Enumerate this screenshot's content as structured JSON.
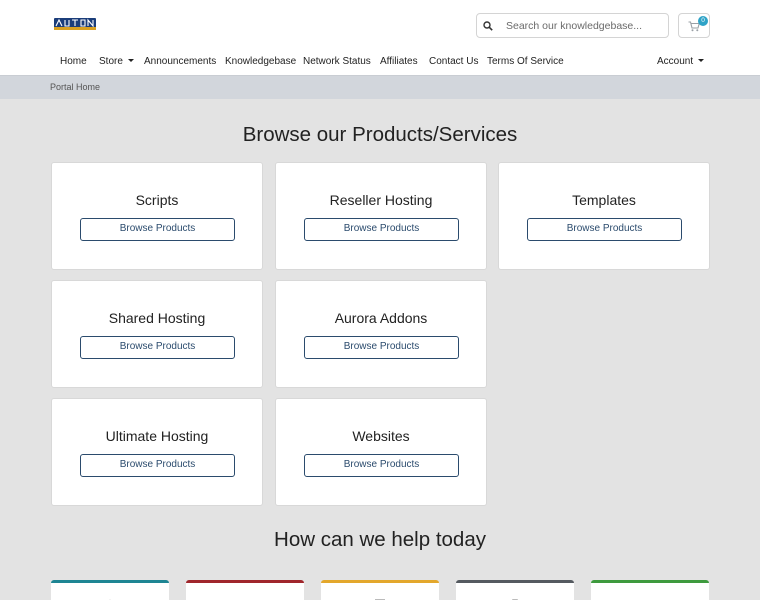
{
  "header": {
    "logo_text": "AUTOMATIONZ",
    "search": {
      "placeholder": "Search our knowledgebase..."
    },
    "cart": {
      "count": "0"
    }
  },
  "nav": {
    "items": [
      {
        "label": "Home"
      },
      {
        "label": "Store"
      },
      {
        "label": "Announcements"
      },
      {
        "label": "Knowledgebase"
      },
      {
        "label": "Network Status"
      },
      {
        "label": "Affiliates"
      },
      {
        "label": "Contact Us"
      },
      {
        "label": "Terms Of Service"
      }
    ],
    "account_label": "Account"
  },
  "breadcrumb": {
    "current": "Portal Home"
  },
  "products": {
    "title": "Browse our Products/Services",
    "button_label": "Browse Products",
    "items": [
      {
        "name": "Scripts"
      },
      {
        "name": "Reseller Hosting"
      },
      {
        "name": "Templates"
      },
      {
        "name": "Shared Hosting"
      },
      {
        "name": "Aurora Addons"
      },
      {
        "name": "Ultimate Hosting"
      },
      {
        "name": "Websites"
      }
    ]
  },
  "help": {
    "title": "How can we help today",
    "cards": [
      {
        "icon": "announcements-icon",
        "color": "#1e8593"
      },
      {
        "icon": "server-status-icon",
        "color": "#a0262c"
      },
      {
        "icon": "knowledgebase-icon",
        "color": "#e3a72c"
      },
      {
        "icon": "downloads-icon",
        "color": "#555a60"
      },
      {
        "icon": "support-icon",
        "color": "#3e9a3e"
      }
    ]
  }
}
